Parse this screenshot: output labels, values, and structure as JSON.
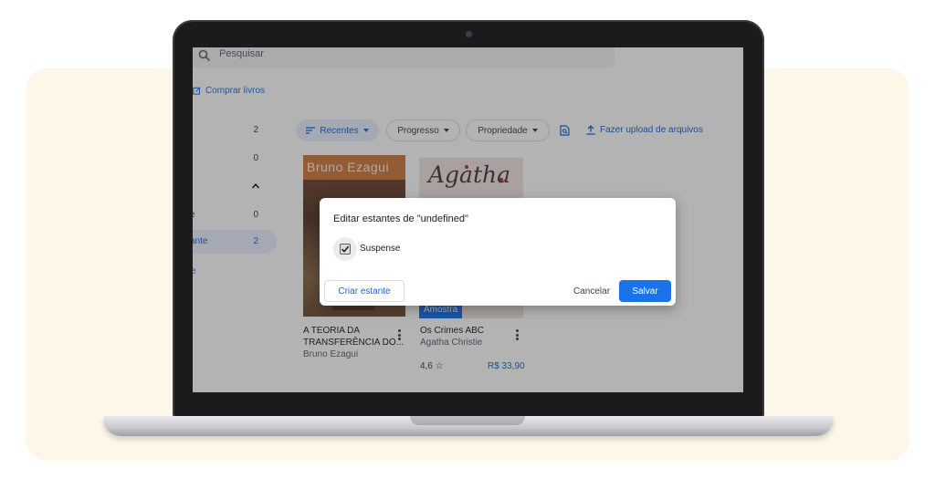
{
  "search": {
    "placeholder": "Pesquisar"
  },
  "sidebar": {
    "buy_link": "Comprar livros",
    "rows": [
      {
        "label": "",
        "count": "2"
      },
      {
        "label": "",
        "count": "0"
      },
      {
        "label": "e",
        "count": "0"
      },
      {
        "label": "ante",
        "count": "2"
      }
    ],
    "more_link": "e"
  },
  "toolbar": {
    "recentes": "Recentes",
    "progresso": "Progresso",
    "propriedade": "Propriedade",
    "upload": "Fazer upload de arquivos"
  },
  "books": [
    {
      "cover_author": "Bruno Ezagui",
      "title_line1": "A TEORIA DA",
      "title_line2": "TRANSFERÊNCIA DO...",
      "author": "Bruno Ezagui"
    },
    {
      "cover_text": "Agatha",
      "sample_badge": "Amostra",
      "title_line1": "Os Crimes ABC",
      "author": "Agatha Christie",
      "rating": "4,6 ☆",
      "price": "R$ 33,90"
    }
  ],
  "dialog": {
    "title": "Editar estantes de \"undefined\"",
    "shelf_label": "Suspense",
    "create_label": "Criar estante",
    "cancel_label": "Cancelar",
    "save_label": "Salvar"
  },
  "colors": {
    "accent": "#1a73e8",
    "backdrop": "#fdf7e9"
  }
}
